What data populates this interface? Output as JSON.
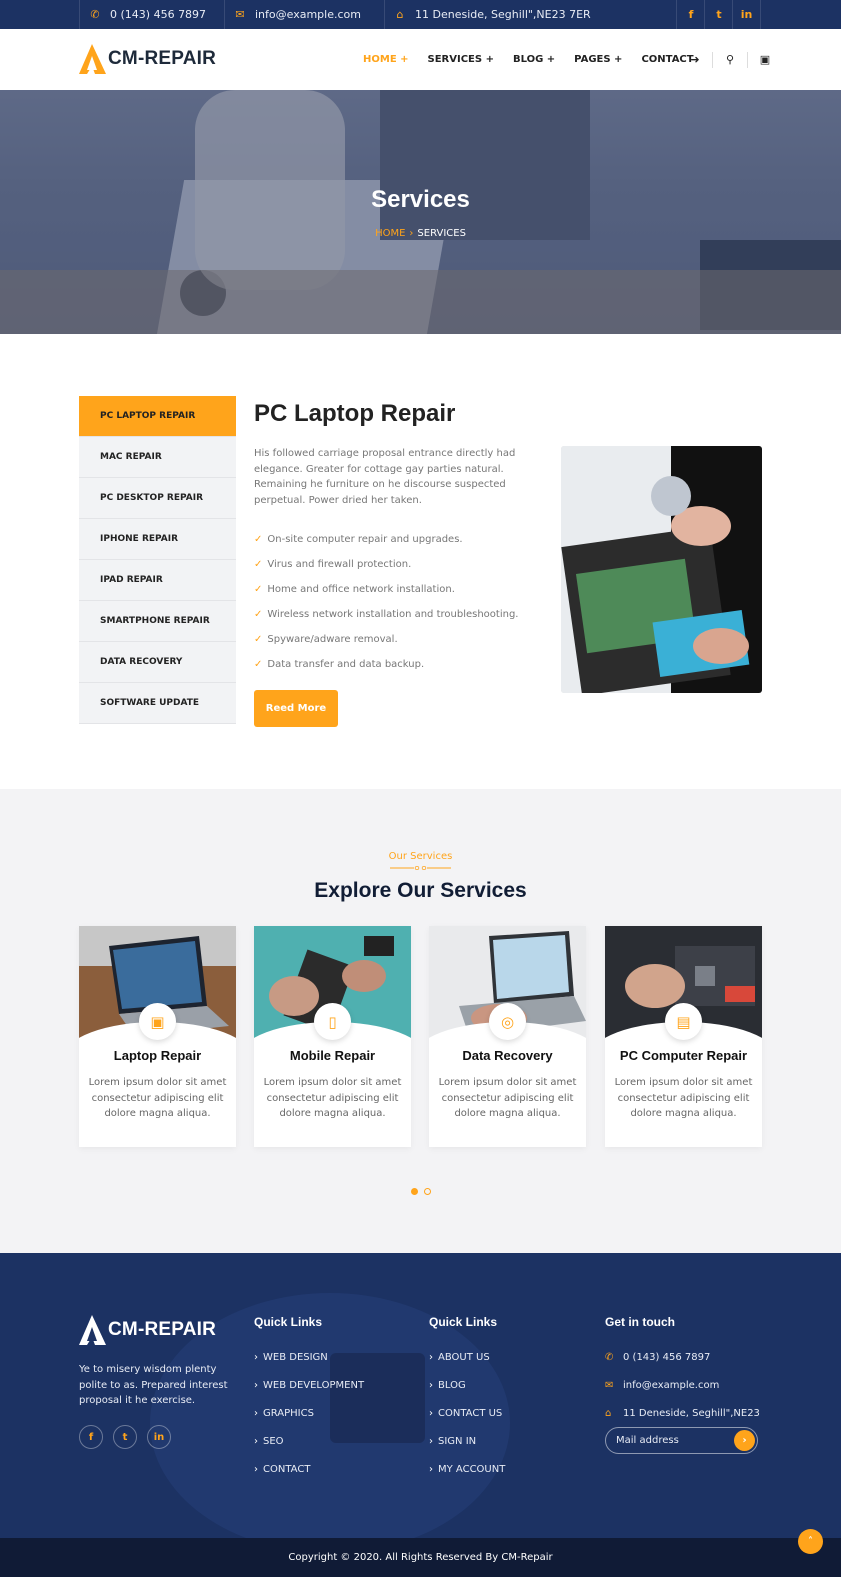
{
  "topbar": {
    "phone": "0 (143) 456 7897",
    "email": "info@example.com",
    "address": "11 Deneside, Seghill\",NE23 7ER",
    "icons": [
      "phone-icon",
      "envelope-icon",
      "home-icon",
      "facebook-icon",
      "twitter-icon",
      "linkedin-icon"
    ]
  },
  "header": {
    "logo_text": "CM-REPAIR",
    "nav": [
      "HOME +",
      "SERVICES +",
      "BLOG +",
      "PAGES +",
      "CONTACT"
    ],
    "icons": [
      "share-icon",
      "search-icon",
      "bag-icon"
    ]
  },
  "hero": {
    "title": "Services",
    "breadcrumb_home": "HOME",
    "breadcrumb_current": "SERVICES"
  },
  "service_menu": [
    "PC LAPTOP REPAIR",
    "MAC REPAIR",
    "PC DESKTOP REPAIR",
    "IPHONE REPAIR",
    "IPAD REPAIR",
    "SMARTPHONE REPAIR",
    "DATA RECOVERY",
    "SOFTWARE UPDATE"
  ],
  "detail": {
    "title": "PC Laptop Repair",
    "description": "His followed carriage proposal entrance directly had elegance. Greater for cottage gay parties natural. Remaining he furniture on he discourse suspected perpetual. Power dried her taken.",
    "features": [
      "On-site computer repair and upgrades.",
      "Virus and firewall protection.",
      "Home and office network installation.",
      "Wireless network installation and troubleshooting.",
      "Spyware/adware removal.",
      "Data transfer and data backup."
    ],
    "button": "Reed More"
  },
  "explore": {
    "subtitle": "Our Services",
    "title": "Explore Our Services",
    "cards": [
      {
        "title": "Laptop Repair",
        "text": "Lorem ipsum dolor sit amet consectetur adipiscing elit dolore magna aliqua.",
        "icon": "laptop-icon"
      },
      {
        "title": "Mobile Repair",
        "text": "Lorem ipsum dolor sit amet consectetur adipiscing elit dolore magna aliqua.",
        "icon": "mobile-icon"
      },
      {
        "title": "Data Recovery",
        "text": "Lorem ipsum dolor sit amet consectetur adipiscing elit dolore magna aliqua.",
        "icon": "data-recovery-icon"
      },
      {
        "title": "PC Computer Repair",
        "text": "Lorem ipsum dolor sit amet consectetur adipiscing elit dolore magna aliqua.",
        "icon": "computer-icon"
      }
    ]
  },
  "footer": {
    "logo_text": "CM-REPAIR",
    "about": "Ye to misery wisdom plenty polite to as. Prepared interest proposal it he exercise.",
    "col1_title": "Quick Links",
    "col1_links": [
      "WEB DESIGN",
      "WEB DEVELOPMENT",
      "GRAPHICS",
      "SEO",
      "CONTACT"
    ],
    "col2_title": "Quick Links",
    "col2_links": [
      "ABOUT US",
      "BLOG",
      "CONTACT US",
      "SIGN IN",
      "MY ACCOUNT"
    ],
    "contact_title": "Get in touch",
    "phone": "0 (143) 456 7897",
    "email": "info@example.com",
    "address": "11 Deneside, Seghill\",NE23",
    "mail_placeholder": "Mail address",
    "copyright": "Copyright © 2020. All Rights Reserved By CM-Repair"
  },
  "colors": {
    "accent": "#ffa41b",
    "navy": "#1c3263",
    "dark_navy": "#101b36"
  }
}
